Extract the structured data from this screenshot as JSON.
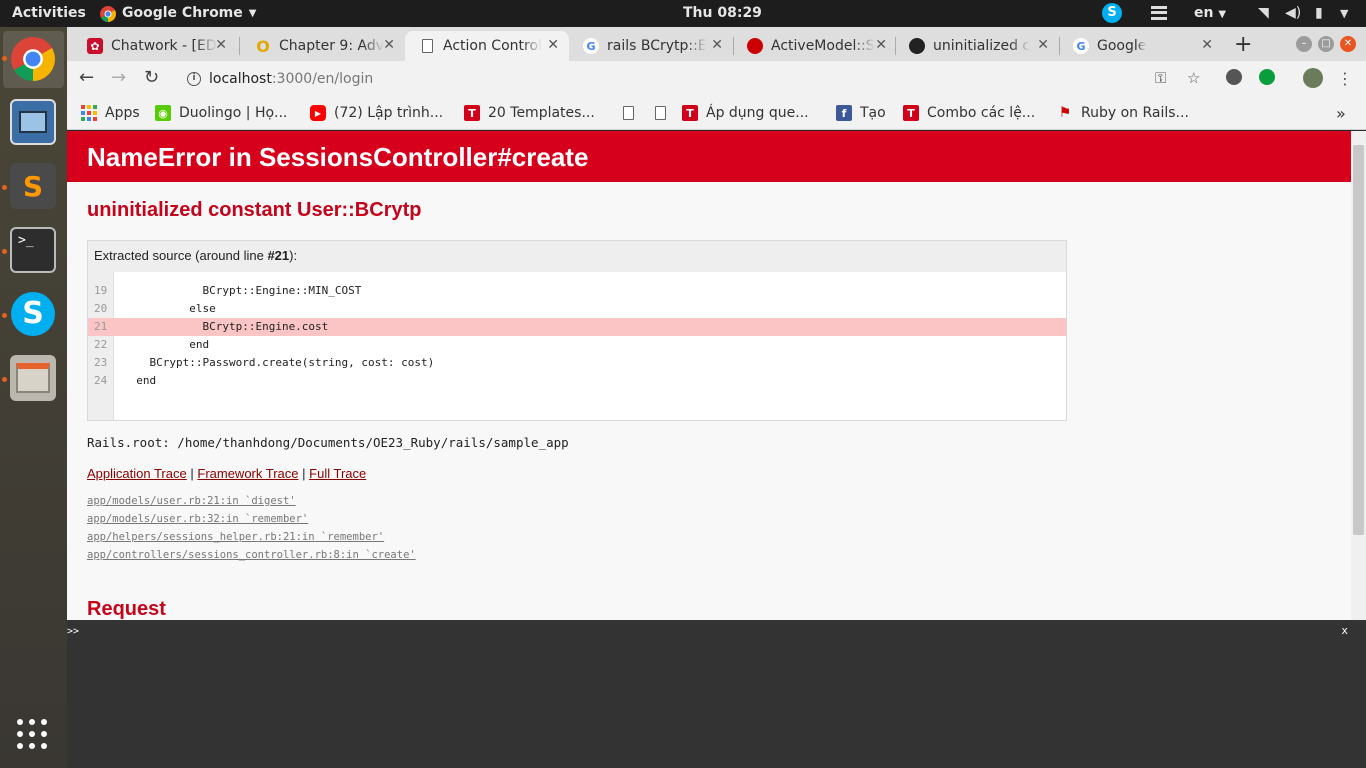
{
  "topbar": {
    "activities": "Activities",
    "app_name": "Google Chrome",
    "clock": "Thu 08:29",
    "lang": "en"
  },
  "tabs": [
    {
      "title": "Chatwork - [ED",
      "icon": "chatwork-icon",
      "color": "#c8102e"
    },
    {
      "title": "Chapter 9: Adv",
      "icon": "railstutorial-icon",
      "color": "#e0a800"
    },
    {
      "title": "Action Control",
      "icon": "document-icon",
      "color": "#777777"
    },
    {
      "title": "rails BCrytp::E",
      "icon": "google-icon",
      "color": "#4285f4"
    },
    {
      "title": "ActiveModel::S",
      "icon": "ruby-icon",
      "color": "#cc0000"
    },
    {
      "title": "uninitialized c",
      "icon": "github-icon",
      "color": "#222222"
    },
    {
      "title": "Google",
      "icon": "google-icon",
      "color": "#4285f4"
    }
  ],
  "omnibox": {
    "host": "localhost",
    "path": ":3000/en/login"
  },
  "bookmarks": [
    {
      "label": "Apps",
      "icon": "apps-grid-icon"
    },
    {
      "label": "Duolingo | Họ...",
      "icon": "duolingo-icon"
    },
    {
      "label": "(72) Lập trình...",
      "icon": "youtube-icon"
    },
    {
      "label": "20 Templates...",
      "icon": "t-icon"
    },
    {
      "label": "",
      "icon": "document-icon"
    },
    {
      "label": "",
      "icon": "document-icon"
    },
    {
      "label": "Áp dụng que...",
      "icon": "t-icon"
    },
    {
      "label": "Tạo",
      "icon": "facebook-icon"
    },
    {
      "label": "Combo các lệ...",
      "icon": "t-icon"
    },
    {
      "label": "Ruby on Rails...",
      "icon": "rails-icon"
    }
  ],
  "page": {
    "header": "NameError in SessionsController#create",
    "error_message": "uninitialized constant User::BCrytp",
    "source_title_prefix": "Extracted source (around line ",
    "source_line_ref": "#21",
    "source_title_suffix": "):",
    "code_lines": [
      {
        "num": "19",
        "code": "            BCrypt::Engine::MIN_COST"
      },
      {
        "num": "20",
        "code": "          else"
      },
      {
        "num": "21",
        "code": "            BCrytp::Engine.cost"
      },
      {
        "num": "22",
        "code": "          end"
      },
      {
        "num": "23",
        "code": "    BCrypt::Password.create(string, cost: cost)"
      },
      {
        "num": "24",
        "code": "  end"
      }
    ],
    "highlighted_line": "21",
    "rails_root": "Rails.root: /home/thanhdong/Documents/OE23_Ruby/rails/sample_app",
    "trace_links": {
      "application": "Application Trace",
      "framework": "Framework Trace",
      "full": "Full Trace",
      "separator": "|"
    },
    "trace_lines": [
      "app/models/user.rb:21:in `digest'",
      "app/models/user.rb:32:in `remember'",
      "app/helpers/sessions_helper.rb:21:in `remember'",
      "app/controllers/sessions_controller.rb:8:in `create'"
    ],
    "request_title": "Request"
  },
  "console": {
    "prompt": ">>",
    "close": "x"
  },
  "colors": {
    "header_red": "#d6001c",
    "error_red": "#c5031a",
    "highlight": "#fcc5c5",
    "ubuntu_orange": "#e95420"
  }
}
